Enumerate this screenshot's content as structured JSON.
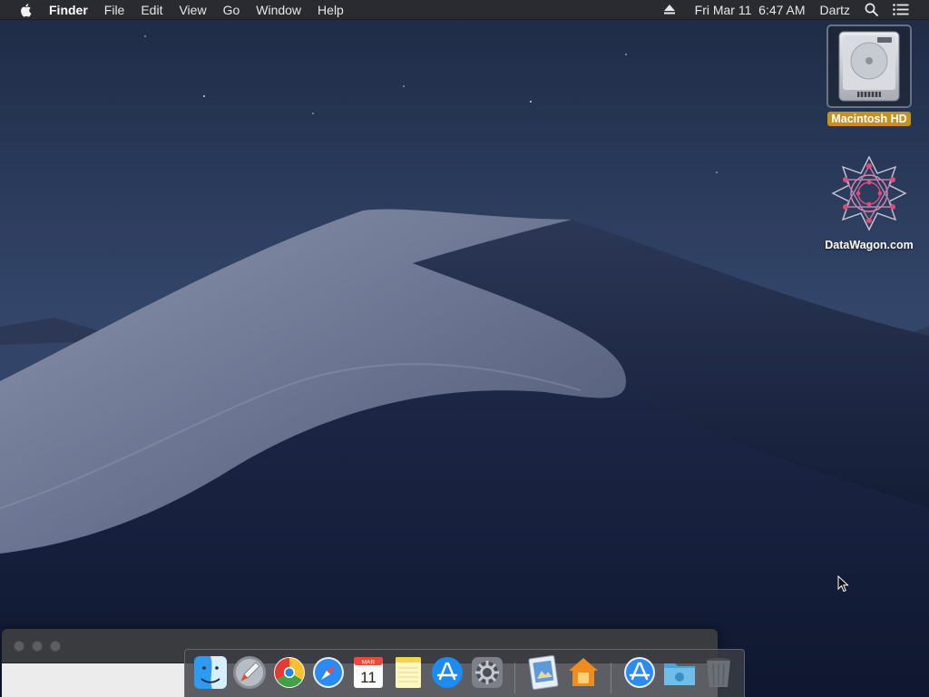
{
  "menubar": {
    "app_name": "Finder",
    "menus": [
      "File",
      "Edit",
      "View",
      "Go",
      "Window",
      "Help"
    ],
    "status": {
      "eject_icon": "eject-icon",
      "datetime": "Fri Mar 11  6:47 AM",
      "user": "Dartz",
      "search_icon": "spotlight-icon",
      "notification_icon": "notification-center-icon"
    }
  },
  "desktop": {
    "icons": [
      {
        "label": "Macintosh HD",
        "icon": "hard-drive-icon",
        "selected": true
      },
      {
        "label": "DataWagon.com",
        "icon": "datawagon-star-icon",
        "selected": false
      }
    ]
  },
  "window": {
    "traffic_lights": [
      "close",
      "minimize",
      "zoom"
    ]
  },
  "dock": {
    "calendar": {
      "month": "MAR",
      "day": "11"
    },
    "items": [
      {
        "name": "Finder",
        "icon": "finder-icon",
        "running": true
      },
      {
        "name": "Launchpad",
        "icon": "launchpad-icon",
        "running": true
      },
      {
        "name": "Google Chrome",
        "icon": "chrome-icon",
        "running": true
      },
      {
        "name": "Safari",
        "icon": "safari-icon",
        "running": true
      },
      {
        "name": "Calendar",
        "icon": "calendar-icon",
        "running": false
      },
      {
        "name": "Notes",
        "icon": "notes-icon",
        "running": false
      },
      {
        "name": "App Store",
        "icon": "app-store-icon",
        "running": false
      },
      {
        "name": "System Preferences",
        "icon": "system-preferences-icon",
        "running": false
      },
      {
        "name": "Preview",
        "icon": "preview-icon",
        "running": false
      },
      {
        "name": "Home",
        "icon": "home-icon",
        "running": true
      },
      {
        "name": "Applications",
        "icon": "applications-folder-icon",
        "running": false
      },
      {
        "name": "Downloads",
        "icon": "downloads-folder-icon",
        "running": false
      },
      {
        "name": "Trash",
        "icon": "trash-icon",
        "running": false
      }
    ]
  },
  "colors": {
    "selection_label": "#c8901e",
    "menubar": "#2a2b30",
    "dock_bg": "#3c3e44"
  }
}
